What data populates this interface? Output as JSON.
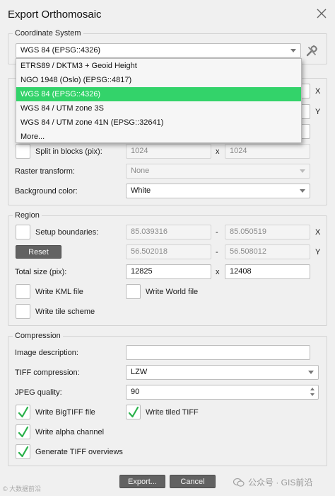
{
  "window": {
    "title": "Export Orthomosaic"
  },
  "coordinate_system": {
    "legend": "Coordinate System",
    "selected": "WGS 84 (EPSG::4326)",
    "options": [
      "ETRS89 / DKTM3 + Geoid Height",
      "NGO 1948 (Oslo) (EPSG::4817)",
      "WGS 84 (EPSG::4326)",
      "WGS 84 / UTM zone 3S",
      "WGS 84 / UTM zone 41N (EPSG::32641)",
      "More..."
    ]
  },
  "raster": {
    "partial_axis_x": "X",
    "partial_axis_y": "Y",
    "split_label": "Split in blocks (pix):",
    "split_w": "1024",
    "split_h": "1024",
    "transform_label": "Raster transform:",
    "transform_value": "None",
    "bg_label": "Background color:",
    "bg_value": "White",
    "x_sep": "x"
  },
  "region": {
    "legend": "Region",
    "setup_label": "Setup boundaries:",
    "x_min": "85.039316",
    "x_max": "85.050519",
    "y_min": "56.502018",
    "y_max": "56.508012",
    "dash": "-",
    "axis_x": "X",
    "axis_y": "Y",
    "reset_label": "Reset",
    "total_label": "Total size (pix):",
    "total_w": "12825",
    "total_h": "12408",
    "x_sep": "x",
    "kml_label": "Write KML file",
    "world_label": "Write World file",
    "tile_label": "Write tile scheme"
  },
  "compression": {
    "legend": "Compression",
    "desc_label": "Image description:",
    "desc_value": "",
    "tiff_label": "TIFF compression:",
    "tiff_value": "LZW",
    "jpeg_label": "JPEG quality:",
    "jpeg_value": "90",
    "bigtiff_label": "Write BigTIFF file",
    "tiled_label": "Write tiled TIFF",
    "alpha_label": "Write alpha channel",
    "overviews_label": "Generate TIFF overviews"
  },
  "buttons": {
    "export": "Export...",
    "cancel": "Cancel"
  },
  "watermarks": {
    "left": "© 大数据前沿",
    "right": "公众号 · GIS前沿"
  },
  "colors": {
    "selection": "#33d36a",
    "check": "#2ab24b",
    "button": "#626262"
  }
}
